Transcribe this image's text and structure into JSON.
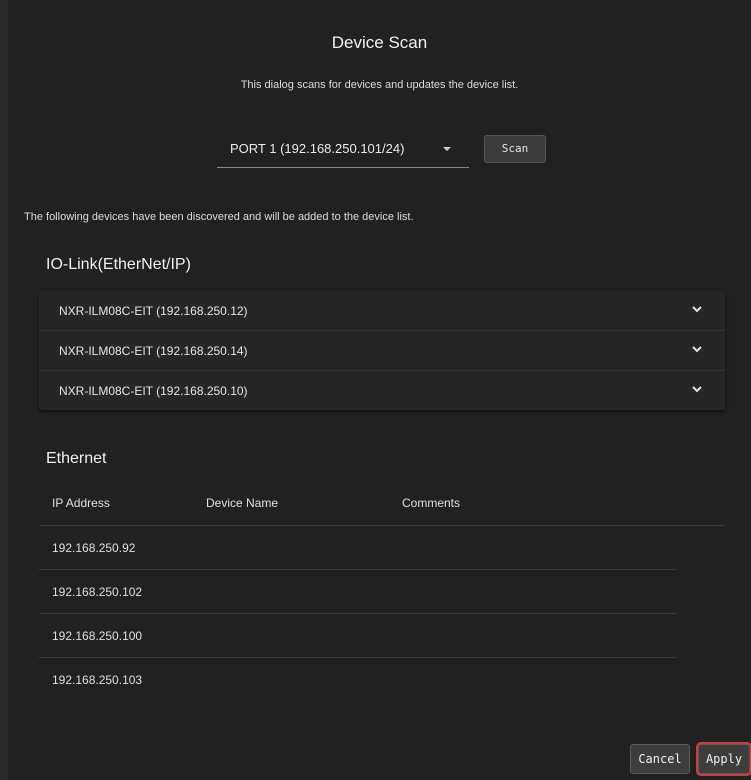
{
  "dialog": {
    "title": "Device Scan",
    "subtitle": "This dialog scans for devices and updates the device list.",
    "port_select": {
      "value": "PORT 1 (192.168.250.101/24)"
    },
    "scan_label": "Scan",
    "discover_note": "The following devices have been discovered and will be added to the device list."
  },
  "iolink": {
    "title": "IO-Link(EtherNet/IP)",
    "devices": [
      "NXR-ILM08C-EIT (192.168.250.12)",
      "NXR-ILM08C-EIT (192.168.250.14)",
      "NXR-ILM08C-EIT (192.168.250.10)"
    ]
  },
  "ethernet": {
    "title": "Ethernet",
    "columns": [
      "IP Address",
      "Device Name",
      "Comments"
    ],
    "rows": [
      {
        "ip": "192.168.250.92",
        "name": "",
        "comments": ""
      },
      {
        "ip": "192.168.250.102",
        "name": "",
        "comments": ""
      },
      {
        "ip": "192.168.250.100",
        "name": "",
        "comments": ""
      },
      {
        "ip": "192.168.250.103",
        "name": "",
        "comments": ""
      }
    ]
  },
  "footer": {
    "cancel_label": "Cancel",
    "apply_label": "Apply"
  },
  "colors": {
    "background": "#212121",
    "highlight": "#d23a3a"
  }
}
